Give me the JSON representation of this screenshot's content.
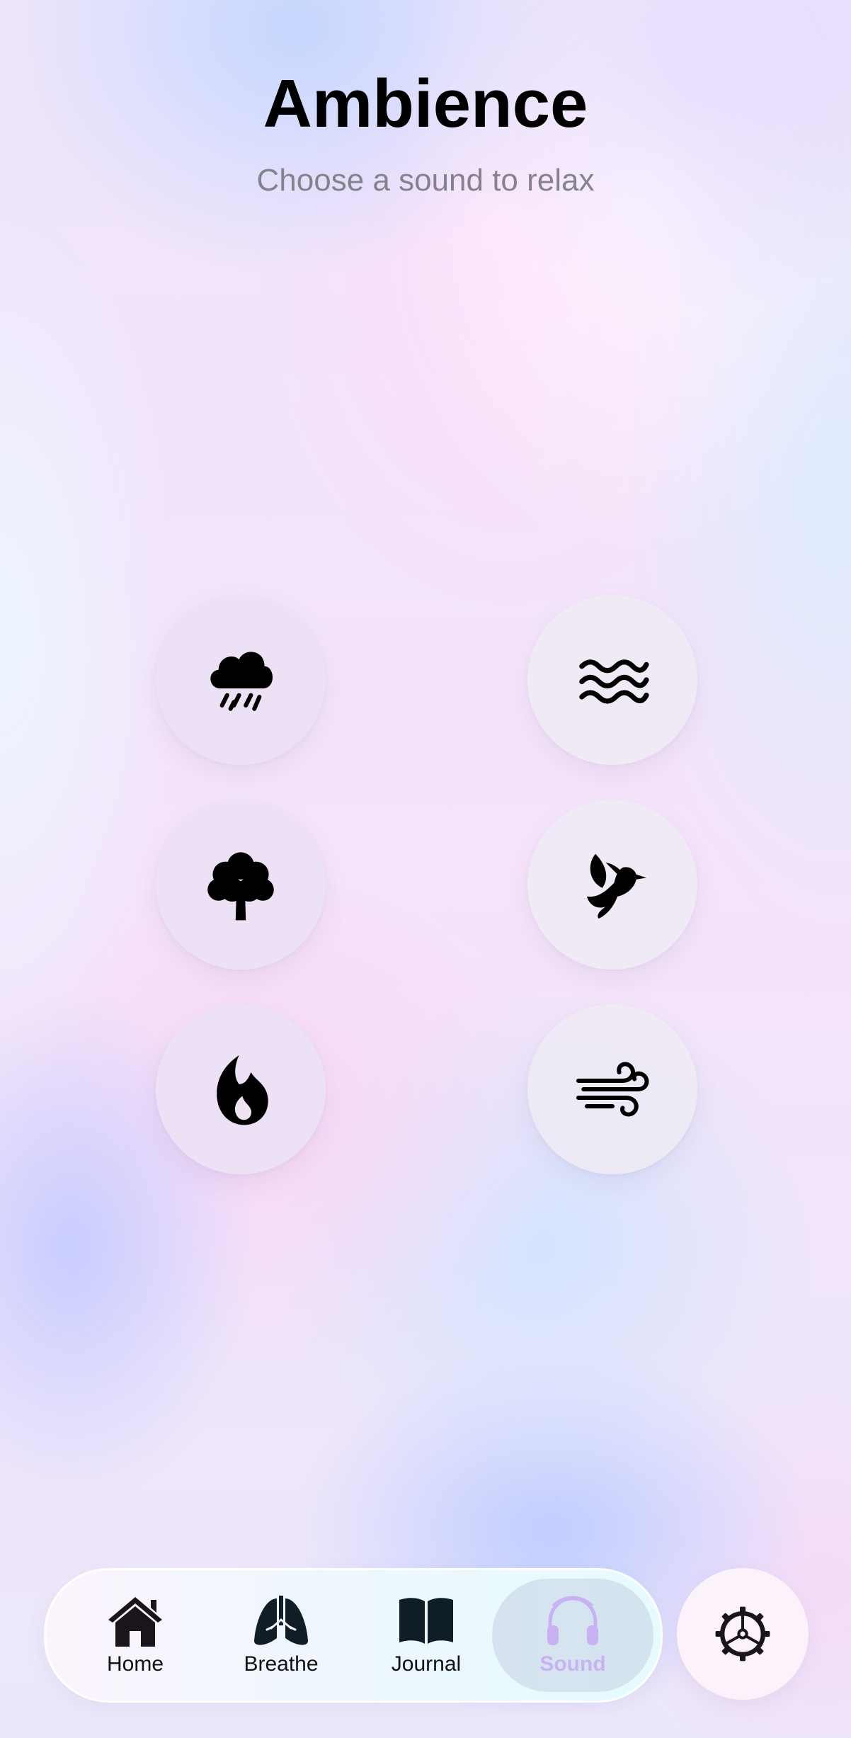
{
  "header": {
    "title": "Ambience",
    "subtitle": "Choose a sound to relax"
  },
  "sounds": [
    {
      "icon": "rain-cloud-icon"
    },
    {
      "icon": "waves-icon"
    },
    {
      "icon": "tree-icon"
    },
    {
      "icon": "bird-icon"
    },
    {
      "icon": "flame-icon"
    },
    {
      "icon": "wind-icon"
    }
  ],
  "tabbar": {
    "items": [
      {
        "label": "Home",
        "icon": "house-icon"
      },
      {
        "label": "Breathe",
        "icon": "lungs-icon"
      },
      {
        "label": "Journal",
        "icon": "book-icon"
      },
      {
        "label": "Sound",
        "icon": "headphones-icon",
        "selected": true
      }
    ]
  },
  "settings": {
    "icon": "gear-icon"
  },
  "colors": {
    "selected_tab_accent": "#c9b2f4",
    "subtitle": "#85828e"
  }
}
